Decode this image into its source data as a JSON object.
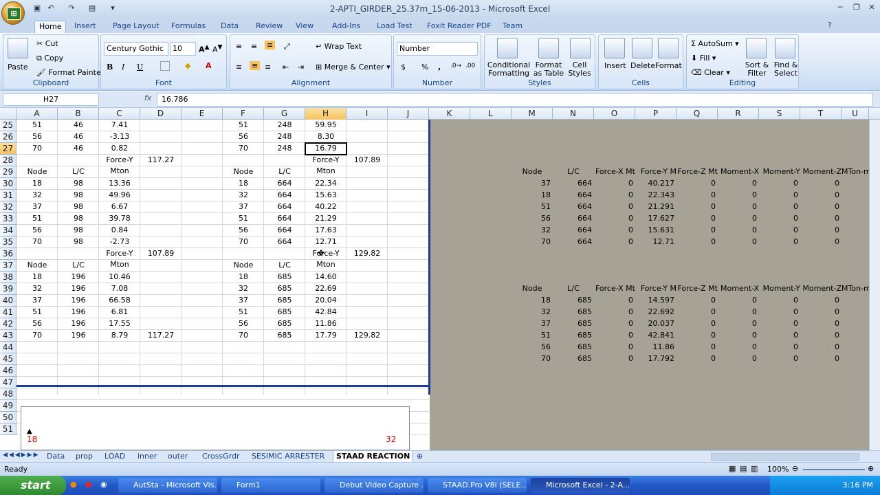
{
  "window": {
    "title": "2-APTI_GIRDER_25.37m_15-06-2013 - Microsoft Excel"
  },
  "tabs": [
    "Home",
    "Insert",
    "Page Layout",
    "Formulas",
    "Data",
    "Review",
    "View",
    "Add-Ins",
    "Load Test",
    "Foxit Reader PDF",
    "Team"
  ],
  "ribbon": {
    "clipboard": {
      "label": "Clipboard",
      "paste": "Paste",
      "cut": "Cut",
      "copy": "Copy",
      "format_painter": "Format Painter"
    },
    "font": {
      "label": "Font",
      "name": "Century Gothic",
      "size": "10"
    },
    "alignment": {
      "label": "Alignment",
      "wrap": "Wrap Text",
      "merge": "Merge & Center"
    },
    "number": {
      "label": "Number",
      "format": "Number",
      "currency": "$",
      "percent": "%",
      "comma": ","
    },
    "styles": {
      "label": "Styles",
      "conditional": "Conditional Formatting",
      "format_table": "Format as Table",
      "cell_styles": "Cell Styles"
    },
    "cells": {
      "label": "Cells",
      "insert": "Insert",
      "delete": "Delete",
      "format": "Format"
    },
    "editing": {
      "label": "Editing",
      "autosum": "AutoSum",
      "fill": "Fill",
      "clear": "Clear",
      "sort": "Sort & Filter",
      "find": "Find & Select"
    }
  },
  "formula_bar": {
    "name_box": "H27",
    "fx": "fx",
    "value": "16.786"
  },
  "columns": [
    "A",
    "B",
    "C",
    "D",
    "E",
    "F",
    "G",
    "H",
    "I",
    "J",
    "K",
    "L",
    "M",
    "N",
    "O",
    "P",
    "Q",
    "R",
    "S",
    "T",
    "U"
  ],
  "rows": [
    "25",
    "26",
    "27",
    "28",
    "29",
    "30",
    "31",
    "32",
    "33",
    "34",
    "35",
    "36",
    "37",
    "38",
    "39",
    "40",
    "41",
    "42",
    "43",
    "44",
    "45",
    "46",
    "47",
    "48",
    "49",
    "50",
    "51"
  ],
  "cells_left": [
    [
      "51",
      "46",
      "7.41",
      "",
      "",
      "51",
      "248",
      "59.95",
      "",
      ""
    ],
    [
      "56",
      "46",
      "-3.13",
      "",
      "",
      "56",
      "248",
      "8.30",
      "",
      ""
    ],
    [
      "70",
      "46",
      "0.82",
      "",
      "",
      "70",
      "248",
      "16.79",
      "",
      ""
    ],
    [
      "",
      "",
      "",
      "117.27",
      "",
      "",
      "",
      "",
      "107.89",
      ""
    ],
    [
      "Node",
      "L/C",
      "Force-Y|Mton",
      "",
      "",
      "Node",
      "L/C",
      "Force-Y|Mton",
      "",
      ""
    ],
    [
      "18",
      "98",
      "13.36",
      "",
      "",
      "18",
      "664",
      "22.34",
      "",
      ""
    ],
    [
      "32",
      "98",
      "49.96",
      "",
      "",
      "32",
      "664",
      "15.63",
      "",
      ""
    ],
    [
      "37",
      "98",
      "6.67",
      "",
      "",
      "37",
      "664",
      "40.22",
      "",
      ""
    ],
    [
      "51",
      "98",
      "39.78",
      "",
      "",
      "51",
      "664",
      "21.29",
      "",
      ""
    ],
    [
      "56",
      "98",
      "0.84",
      "",
      "",
      "56",
      "664",
      "17.63",
      "",
      ""
    ],
    [
      "70",
      "98",
      "-2.73",
      "",
      "",
      "70",
      "664",
      "12.71",
      "",
      ""
    ],
    [
      "",
      "",
      "",
      "107.89",
      "",
      "",
      "",
      "",
      "129.82",
      ""
    ],
    [
      "Node",
      "L/C",
      "Force-Y|Mton",
      "",
      "",
      "Node",
      "L/C",
      "Force-Y|Mton",
      "",
      ""
    ],
    [
      "18",
      "196",
      "10.46",
      "",
      "",
      "18",
      "685",
      "14.60",
      "",
      ""
    ],
    [
      "32",
      "196",
      "7.08",
      "",
      "",
      "32",
      "685",
      "22.69",
      "",
      ""
    ],
    [
      "37",
      "196",
      "66.58",
      "",
      "",
      "37",
      "685",
      "20.04",
      "",
      ""
    ],
    [
      "51",
      "196",
      "6.81",
      "",
      "",
      "51",
      "685",
      "42.84",
      "",
      ""
    ],
    [
      "56",
      "196",
      "17.55",
      "",
      "",
      "56",
      "685",
      "11.86",
      "",
      ""
    ],
    [
      "70",
      "196",
      "8.79",
      "117.27",
      "",
      "70",
      "685",
      "17.79",
      "129.82",
      ""
    ]
  ],
  "right_table1": {
    "header": [
      "Node",
      "L/C",
      "Force-X Mt",
      "Force-Y M",
      "Force-Z Mt",
      "Moment-X",
      "Moment-Y",
      "Moment-Z",
      "MTon-m"
    ],
    "rows": [
      [
        "37",
        "664",
        "0",
        "40.217",
        "0",
        "0",
        "0",
        "0"
      ],
      [
        "18",
        "664",
        "0",
        "22.343",
        "0",
        "0",
        "0",
        "0"
      ],
      [
        "51",
        "664",
        "0",
        "21.291",
        "0",
        "0",
        "0",
        "0"
      ],
      [
        "56",
        "664",
        "0",
        "17.627",
        "0",
        "0",
        "0",
        "0"
      ],
      [
        "32",
        "664",
        "0",
        "15.631",
        "0",
        "0",
        "0",
        "0"
      ],
      [
        "70",
        "664",
        "0",
        "12.71",
        "0",
        "0",
        "0",
        "0"
      ]
    ]
  },
  "right_table2": {
    "header": [
      "Node",
      "L/C",
      "Force-X Mt",
      "Force-Y M",
      "Force-Z Mt",
      "Moment-X",
      "Moment-Y",
      "Moment-Z",
      "MTon-m"
    ],
    "rows": [
      [
        "18",
        "685",
        "0",
        "14.597",
        "0",
        "0",
        "0",
        "0"
      ],
      [
        "32",
        "685",
        "0",
        "22.692",
        "0",
        "0",
        "0",
        "0"
      ],
      [
        "37",
        "685",
        "0",
        "20.037",
        "0",
        "0",
        "0",
        "0"
      ],
      [
        "51",
        "685",
        "0",
        "42.841",
        "0",
        "0",
        "0",
        "0"
      ],
      [
        "56",
        "685",
        "0",
        "11.86",
        "0",
        "0",
        "0",
        "0"
      ],
      [
        "70",
        "685",
        "0",
        "17.792",
        "0",
        "0",
        "0",
        "0"
      ]
    ]
  },
  "chart_labels": {
    "left": "18",
    "right": "32"
  },
  "sheet_tabs": [
    "Data",
    "prop",
    "LOAD",
    "inner",
    "outer",
    "CrossGrdr",
    "SESIMIC ARRESTER",
    "STAAD REACTION"
  ],
  "status": {
    "ready": "Ready",
    "zoom": "100%"
  },
  "taskbar": {
    "start": "start",
    "items": [
      "AutSta - Microsoft Vis...",
      "Form1",
      "Debut Video Capture ...",
      "STAAD.Pro V8i (SELE...",
      "Microsoft Excel - 2-A..."
    ],
    "time": "3:16 PM"
  },
  "colors": {
    "selection_header": "#f7c25e",
    "frozen_line": "#1f3a93",
    "gray_area": "#a6a295"
  }
}
